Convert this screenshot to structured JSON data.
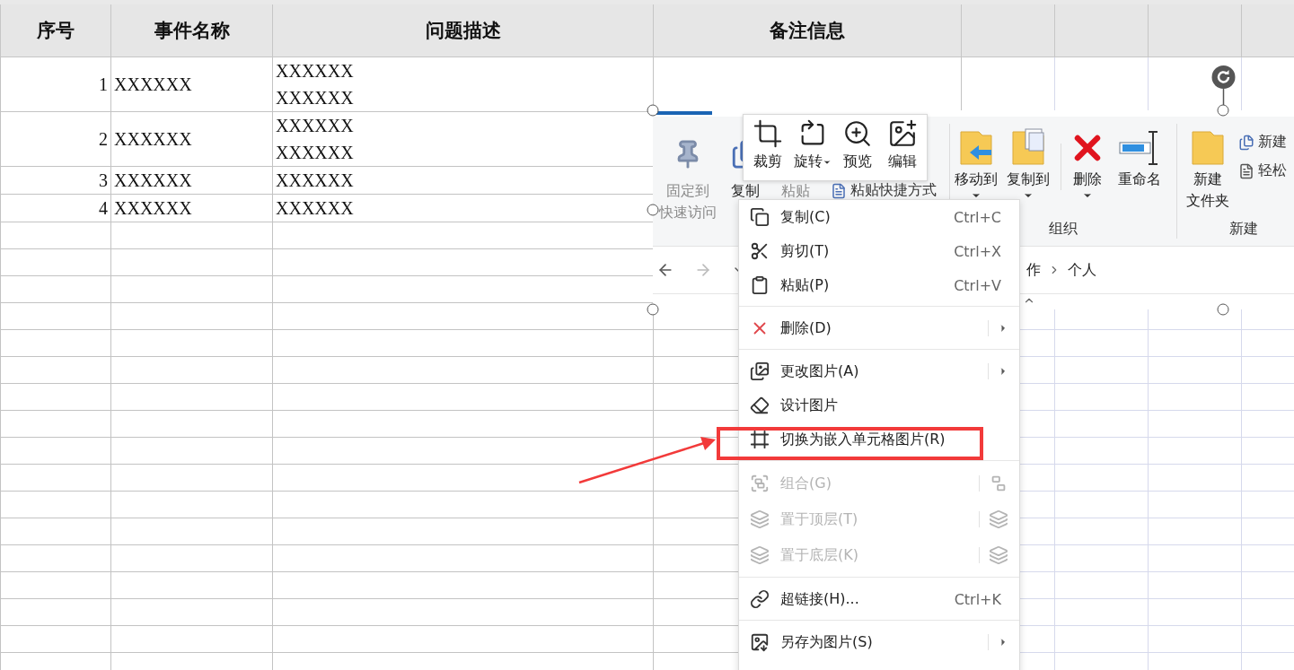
{
  "sheet": {
    "columns": [
      "序号",
      "事件名称",
      "问题描述",
      "备注信息"
    ],
    "rows": [
      {
        "number": "1",
        "name": "XXXXXX",
        "description": [
          "XXXXXX",
          "XXXXXX"
        ]
      },
      {
        "number": "2",
        "name": "XXXXXX",
        "description": [
          "XXXXXX",
          "XXXXXX"
        ]
      },
      {
        "number": "3",
        "name": "XXXXXX",
        "description": [
          "XXXXXX"
        ]
      },
      {
        "number": "4",
        "name": "XXXXXX",
        "description": [
          "XXXXXX"
        ]
      }
    ]
  },
  "embedded_picture": {
    "clipboard_buttons": [
      {
        "lines": [
          "固定到",
          "快速访问"
        ],
        "disabled": true
      },
      {
        "lines": [
          "复制"
        ],
        "disabled": false
      },
      {
        "lines": [
          "粘贴"
        ],
        "disabled": true
      }
    ],
    "paste_shortcut": "粘贴快捷方式",
    "organize_group": {
      "label": "组织",
      "buttons": [
        {
          "label": "移动到",
          "dropdown": true
        },
        {
          "label": "复制到",
          "dropdown": true
        },
        {
          "label": "删除",
          "dropdown": true
        },
        {
          "label": "重命名",
          "dropdown": false
        }
      ]
    },
    "new_group": {
      "label": "新建",
      "folder_lines": [
        "新建",
        "文件夹"
      ],
      "small_items": [
        "新建",
        "轻松"
      ]
    },
    "address_path": [
      "作",
      "个人"
    ]
  },
  "mini_toolbar": [
    {
      "label": "裁剪",
      "dropdown": false
    },
    {
      "label": "旋转",
      "dropdown": true
    },
    {
      "label": "预览",
      "dropdown": false
    },
    {
      "label": "编辑",
      "dropdown": false
    }
  ],
  "context_menu": [
    {
      "kind": "item",
      "label": "复制(C)",
      "shortcut": "Ctrl+C",
      "submenu": false,
      "disabled": false,
      "annotated": false
    },
    {
      "kind": "item",
      "label": "剪切(T)",
      "shortcut": "Ctrl+X",
      "submenu": false,
      "disabled": false,
      "annotated": false
    },
    {
      "kind": "item",
      "label": "粘贴(P)",
      "shortcut": "Ctrl+V",
      "submenu": false,
      "disabled": false,
      "annotated": false
    },
    {
      "kind": "separator"
    },
    {
      "kind": "item",
      "label": "删除(D)",
      "submenu": true,
      "disabled": false,
      "annotated": false
    },
    {
      "kind": "separator"
    },
    {
      "kind": "item",
      "label": "更改图片(A)",
      "submenu": true,
      "disabled": false,
      "annotated": false
    },
    {
      "kind": "item",
      "label": "设计图片",
      "submenu": false,
      "disabled": false,
      "annotated": false
    },
    {
      "kind": "item",
      "label": "切换为嵌入单元格图片(R)",
      "submenu": false,
      "disabled": false,
      "annotated": true
    },
    {
      "kind": "separator"
    },
    {
      "kind": "item",
      "label": "组合(G)",
      "submenu": false,
      "disabled": true,
      "annotated": false
    },
    {
      "kind": "item",
      "label": "置于顶层(T)",
      "submenu": false,
      "disabled": true,
      "annotated": false
    },
    {
      "kind": "item",
      "label": "置于底层(K)",
      "submenu": false,
      "disabled": true,
      "annotated": false
    },
    {
      "kind": "separator"
    },
    {
      "kind": "item",
      "label": "超链接(H)...",
      "shortcut": "Ctrl+K",
      "submenu": false,
      "disabled": false,
      "annotated": false
    },
    {
      "kind": "separator"
    },
    {
      "kind": "item",
      "label": "另存为图片(S)",
      "submenu": true,
      "disabled": false,
      "annotated": false
    }
  ]
}
